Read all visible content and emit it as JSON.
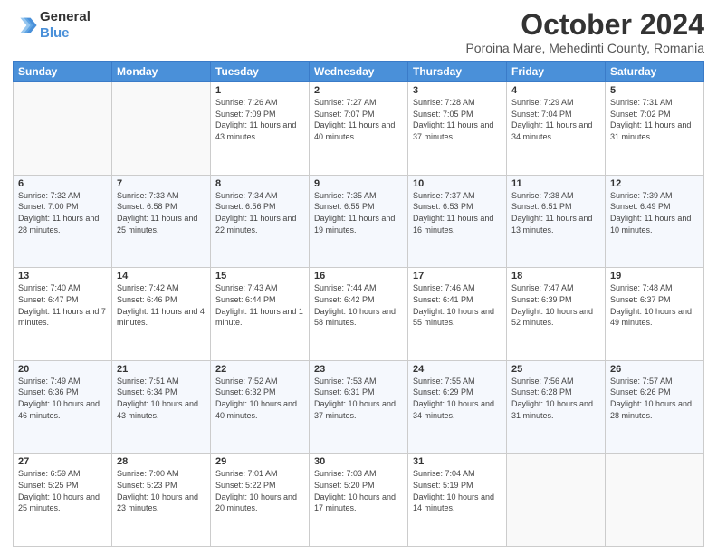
{
  "header": {
    "logo_line1": "General",
    "logo_line2": "Blue",
    "title": "October 2024",
    "subtitle": "Poroina Mare, Mehedinti County, Romania"
  },
  "days_of_week": [
    "Sunday",
    "Monday",
    "Tuesday",
    "Wednesday",
    "Thursday",
    "Friday",
    "Saturday"
  ],
  "weeks": [
    [
      {
        "day": "",
        "info": ""
      },
      {
        "day": "",
        "info": ""
      },
      {
        "day": "1",
        "info": "Sunrise: 7:26 AM\nSunset: 7:09 PM\nDaylight: 11 hours and 43 minutes."
      },
      {
        "day": "2",
        "info": "Sunrise: 7:27 AM\nSunset: 7:07 PM\nDaylight: 11 hours and 40 minutes."
      },
      {
        "day": "3",
        "info": "Sunrise: 7:28 AM\nSunset: 7:05 PM\nDaylight: 11 hours and 37 minutes."
      },
      {
        "day": "4",
        "info": "Sunrise: 7:29 AM\nSunset: 7:04 PM\nDaylight: 11 hours and 34 minutes."
      },
      {
        "day": "5",
        "info": "Sunrise: 7:31 AM\nSunset: 7:02 PM\nDaylight: 11 hours and 31 minutes."
      }
    ],
    [
      {
        "day": "6",
        "info": "Sunrise: 7:32 AM\nSunset: 7:00 PM\nDaylight: 11 hours and 28 minutes."
      },
      {
        "day": "7",
        "info": "Sunrise: 7:33 AM\nSunset: 6:58 PM\nDaylight: 11 hours and 25 minutes."
      },
      {
        "day": "8",
        "info": "Sunrise: 7:34 AM\nSunset: 6:56 PM\nDaylight: 11 hours and 22 minutes."
      },
      {
        "day": "9",
        "info": "Sunrise: 7:35 AM\nSunset: 6:55 PM\nDaylight: 11 hours and 19 minutes."
      },
      {
        "day": "10",
        "info": "Sunrise: 7:37 AM\nSunset: 6:53 PM\nDaylight: 11 hours and 16 minutes."
      },
      {
        "day": "11",
        "info": "Sunrise: 7:38 AM\nSunset: 6:51 PM\nDaylight: 11 hours and 13 minutes."
      },
      {
        "day": "12",
        "info": "Sunrise: 7:39 AM\nSunset: 6:49 PM\nDaylight: 11 hours and 10 minutes."
      }
    ],
    [
      {
        "day": "13",
        "info": "Sunrise: 7:40 AM\nSunset: 6:47 PM\nDaylight: 11 hours and 7 minutes."
      },
      {
        "day": "14",
        "info": "Sunrise: 7:42 AM\nSunset: 6:46 PM\nDaylight: 11 hours and 4 minutes."
      },
      {
        "day": "15",
        "info": "Sunrise: 7:43 AM\nSunset: 6:44 PM\nDaylight: 11 hours and 1 minute."
      },
      {
        "day": "16",
        "info": "Sunrise: 7:44 AM\nSunset: 6:42 PM\nDaylight: 10 hours and 58 minutes."
      },
      {
        "day": "17",
        "info": "Sunrise: 7:46 AM\nSunset: 6:41 PM\nDaylight: 10 hours and 55 minutes."
      },
      {
        "day": "18",
        "info": "Sunrise: 7:47 AM\nSunset: 6:39 PM\nDaylight: 10 hours and 52 minutes."
      },
      {
        "day": "19",
        "info": "Sunrise: 7:48 AM\nSunset: 6:37 PM\nDaylight: 10 hours and 49 minutes."
      }
    ],
    [
      {
        "day": "20",
        "info": "Sunrise: 7:49 AM\nSunset: 6:36 PM\nDaylight: 10 hours and 46 minutes."
      },
      {
        "day": "21",
        "info": "Sunrise: 7:51 AM\nSunset: 6:34 PM\nDaylight: 10 hours and 43 minutes."
      },
      {
        "day": "22",
        "info": "Sunrise: 7:52 AM\nSunset: 6:32 PM\nDaylight: 10 hours and 40 minutes."
      },
      {
        "day": "23",
        "info": "Sunrise: 7:53 AM\nSunset: 6:31 PM\nDaylight: 10 hours and 37 minutes."
      },
      {
        "day": "24",
        "info": "Sunrise: 7:55 AM\nSunset: 6:29 PM\nDaylight: 10 hours and 34 minutes."
      },
      {
        "day": "25",
        "info": "Sunrise: 7:56 AM\nSunset: 6:28 PM\nDaylight: 10 hours and 31 minutes."
      },
      {
        "day": "26",
        "info": "Sunrise: 7:57 AM\nSunset: 6:26 PM\nDaylight: 10 hours and 28 minutes."
      }
    ],
    [
      {
        "day": "27",
        "info": "Sunrise: 6:59 AM\nSunset: 5:25 PM\nDaylight: 10 hours and 25 minutes."
      },
      {
        "day": "28",
        "info": "Sunrise: 7:00 AM\nSunset: 5:23 PM\nDaylight: 10 hours and 23 minutes."
      },
      {
        "day": "29",
        "info": "Sunrise: 7:01 AM\nSunset: 5:22 PM\nDaylight: 10 hours and 20 minutes."
      },
      {
        "day": "30",
        "info": "Sunrise: 7:03 AM\nSunset: 5:20 PM\nDaylight: 10 hours and 17 minutes."
      },
      {
        "day": "31",
        "info": "Sunrise: 7:04 AM\nSunset: 5:19 PM\nDaylight: 10 hours and 14 minutes."
      },
      {
        "day": "",
        "info": ""
      },
      {
        "day": "",
        "info": ""
      }
    ]
  ]
}
